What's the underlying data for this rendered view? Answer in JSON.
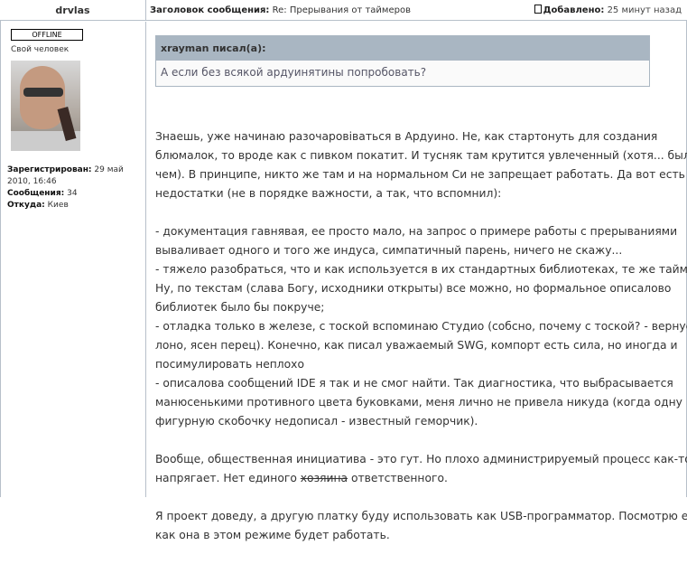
{
  "header": {
    "author": "drvlas",
    "subject_label": "Заголовок сообщения:",
    "subject": "Re: Прерывания от таймеров",
    "date_label": "Добавлено:",
    "date": "25 минут назад"
  },
  "user": {
    "status": "OFFLINE",
    "rank": "Свой человек",
    "registered_label": "Зарегистрирован:",
    "registered": "29 май 2010, 16:46",
    "posts_label": "Сообщения:",
    "posts": "34",
    "from_label": "Откуда:",
    "from": "Киев"
  },
  "quote": {
    "author": "xrayman писал(а):",
    "text": "А если без всякой ардуинятины попробовать?"
  },
  "body": {
    "p1": [
      "Знаешь, уже начинаю разочаровіваться в Ардуино. Не, как стартонуть для создания",
      "блюмалок, то вроде как с пивком покатит. И тусняк там крутится увлеченный (хотя... было бы",
      "чем). В принципе, никто же там и на нормальном Си не запрещает работать. Да вот есть и",
      "недостатки (не в порядке важности, а так, что вспомнил):"
    ],
    "p2": [
      "- документация гавнявая, ее просто мало, на запрос о примере работы с прерываниями",
      "вываливает одного и того же индуса, симпатичный парень, ничего не скажу...",
      "- тяжело разобраться, что и как используется в их стандартных библиотеках, те же таймеры.",
      "Ну, по текстам (слава Богу, исходники открыты) все можно, но формальное описалово",
      "библиотек было бы покруче;",
      "- отладка только в железе, с тоской вспоминаю Студио (собсно, почему с тоской? - вернусь в",
      "лоно, ясен перец). Конечно, как писал уважаемый SWG, компорт есть сила, но иногда и",
      "посимулировать неплохо",
      "- описалова сообщений IDE я так и не смог найти. Так диагностика, что выбрасывается",
      "манюсенькими противного цвета буковками, меня лично не привела никуда (когда одну",
      "фигурную скобочку недописал - известный геморчик)."
    ],
    "p3_line1": "Вообще, общественная инициатива - это гут. Но плохо администрируемый процесс как-то",
    "p3_line2_a": "напрягает. Нет единого ",
    "p3_line2_strike": "хозяина",
    "p3_line2_b": " ответственного.",
    "p4": [
      "Я проект доведу, а другую платку буду использовать как USB-программатор. Посмотрю еще,",
      "как она в этом режиме будет работать."
    ]
  }
}
